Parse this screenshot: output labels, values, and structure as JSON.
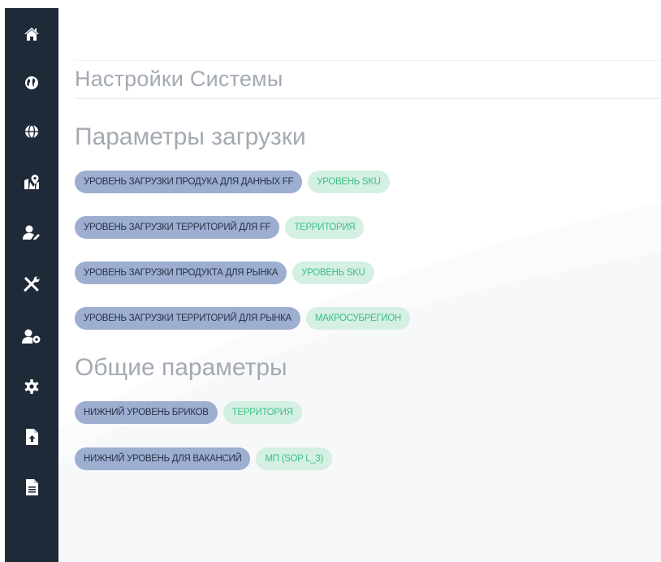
{
  "sidebar": {
    "items": [
      {
        "icon": "home-icon"
      },
      {
        "icon": "globe-americas-icon"
      },
      {
        "icon": "globe-icon"
      },
      {
        "icon": "map-marker-icon"
      },
      {
        "icon": "user-edit-icon"
      },
      {
        "icon": "tools-icon"
      },
      {
        "icon": "user-cog-icon"
      },
      {
        "icon": "cog-icon"
      },
      {
        "icon": "file-upload-icon"
      },
      {
        "icon": "file-alt-icon"
      }
    ]
  },
  "page": {
    "title": "Настройки Системы"
  },
  "sections": [
    {
      "title": "Параметры загрузки",
      "params": [
        {
          "label": "УРОВЕНЬ ЗАГРУЗКИ ПРОДУКА ДЛЯ ДАННЫХ FF",
          "value": "УРОВЕНЬ SKU"
        },
        {
          "label": "УРОВЕНЬ ЗАГРУЗКИ ТЕРРИТОРИЙ ДЛЯ FF",
          "value": "ТЕРРИТОРИЯ"
        },
        {
          "label": "УРОВЕНЬ ЗАГРУЗКИ ПРОДУКТА ДЛЯ РЫНКА",
          "value": "УРОВЕНЬ SKU"
        },
        {
          "label": "УРОВЕНЬ ЗАГРУЗКИ ТЕРРИТОРИЙ ДЛЯ РЫНКА",
          "value": "МАКРОСУБРЕГИОН"
        }
      ]
    },
    {
      "title": "Общие параметры",
      "params": [
        {
          "label": "НИЖНИЙ УРОВЕНЬ БРИКОВ",
          "value": "ТЕРРИТОРИЯ"
        },
        {
          "label": "НИЖНИЙ УРОВЕНЬ ДЛЯ ВАКАНСИЙ",
          "value": "МП (SOP L_3)"
        }
      ]
    }
  ],
  "colors": {
    "sidebar_bg": "#1f2a38",
    "key_pill_bg": "#9daed1",
    "value_pill_bg": "#d3f0e2",
    "value_pill_text": "#3fbf86",
    "heading_text": "#a4aab2"
  }
}
